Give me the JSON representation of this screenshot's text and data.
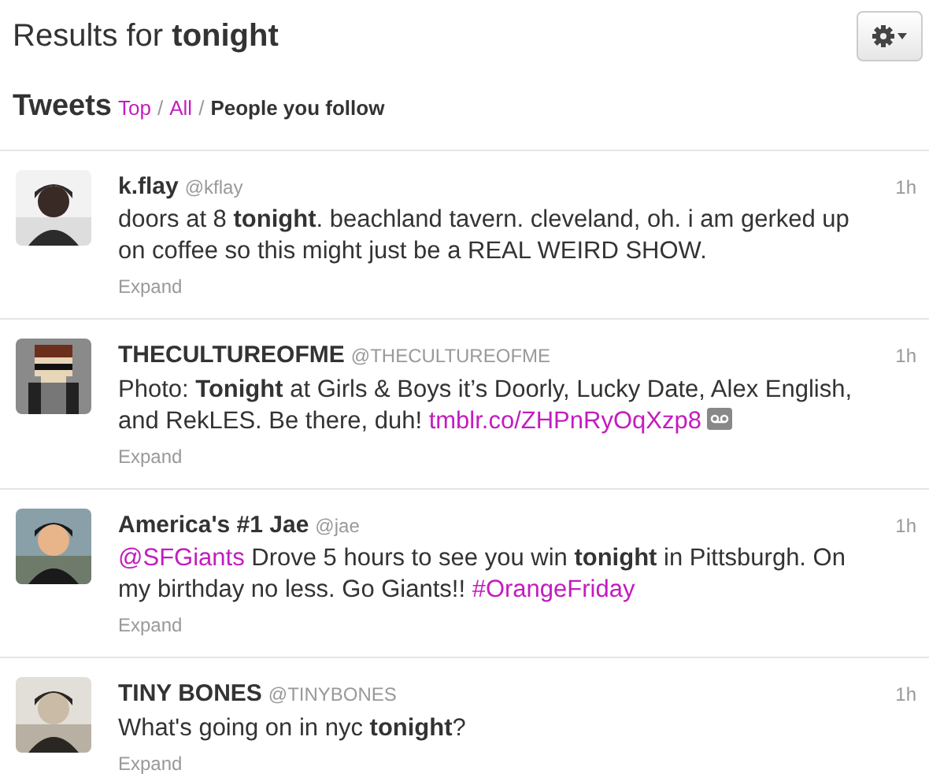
{
  "header": {
    "title": "Results for **tonight**"
  },
  "section": {
    "title": "Tweets",
    "filters": [
      {
        "label": "Top",
        "selected": false
      },
      {
        "label": "All",
        "selected": false
      },
      {
        "label": "People you follow",
        "selected": true
      }
    ],
    "separators": [
      "/",
      "/"
    ]
  },
  "tweets": [
    {
      "name": "k.flay",
      "handle": "@kflay",
      "time": "1h",
      "avatar": {
        "kind": "picture"
      },
      "text": [
        {
          "kind": "text",
          "text": "doors at 8 **tonight**. beachland tavern. cleveland, oh. i am gerked up on coffee so this might just be a REAL WEIRD SHOW."
        }
      ],
      "media": false,
      "expand": "Expand"
    },
    {
      "name": "THECULTUREOFME",
      "handle": "@THECULTUREOFME",
      "time": "1h",
      "avatar": {
        "kind": "pixel"
      },
      "text": [
        {
          "kind": "text",
          "text": "Photo: **Tonight** at Girls & Boys it’s Doorly, Lucky Date, Alex English, and RekLES. Be there, duh! "
        },
        {
          "kind": "link",
          "text": "tmblr.co/ZHPnRyOqXzp8"
        }
      ],
      "media": true,
      "expand": "Expand"
    },
    {
      "name": "America's #1 Jae",
      "handle": "@jae",
      "time": "1h",
      "avatar": {
        "kind": "picture"
      },
      "text": [
        {
          "kind": "link",
          "text": "@SFGiants"
        },
        {
          "kind": "text",
          "text": " Drove 5 hours to see you win **tonight** in Pittsburgh. On my birthday no less. Go Giants!! "
        },
        {
          "kind": "link",
          "text": "#OrangeFriday"
        }
      ],
      "media": false,
      "expand": "Expand"
    },
    {
      "name": "TINY BONES",
      "handle": "@TINYBONES",
      "time": "1h",
      "avatar": {
        "kind": "picture"
      },
      "text": [
        {
          "kind": "text",
          "text": "What's going on in nyc **tonight**?"
        }
      ],
      "media": false,
      "expand": "Expand"
    }
  ]
}
